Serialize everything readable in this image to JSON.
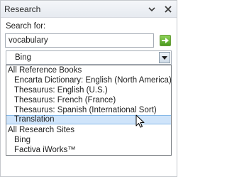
{
  "pane": {
    "title": "Research",
    "menu_icon": "chevron-down-icon",
    "close_icon": "close-icon"
  },
  "search": {
    "label": "Search for:",
    "value": "vocabulary",
    "go_icon": "arrow-right-icon"
  },
  "source": {
    "selected": "Bing",
    "expanded": true
  },
  "options": [
    {
      "label": "All Reference Books",
      "kind": "group"
    },
    {
      "label": "Encarta Dictionary: English (North America)",
      "kind": "item"
    },
    {
      "label": "Thesaurus: English (U.S.)",
      "kind": "item"
    },
    {
      "label": "Thesaurus: French (France)",
      "kind": "item"
    },
    {
      "label": "Thesaurus: Spanish (International Sort)",
      "kind": "item"
    },
    {
      "label": "Translation",
      "kind": "item",
      "highlighted": true
    },
    {
      "label": "All Research Sites",
      "kind": "group"
    },
    {
      "label": "Bing",
      "kind": "item"
    },
    {
      "label": "Factiva iWorks™",
      "kind": "item"
    }
  ],
  "colors": {
    "highlight": "#cfe4fa",
    "highlight_border": "#86b9e8",
    "go_button": "#5aaa2a"
  }
}
